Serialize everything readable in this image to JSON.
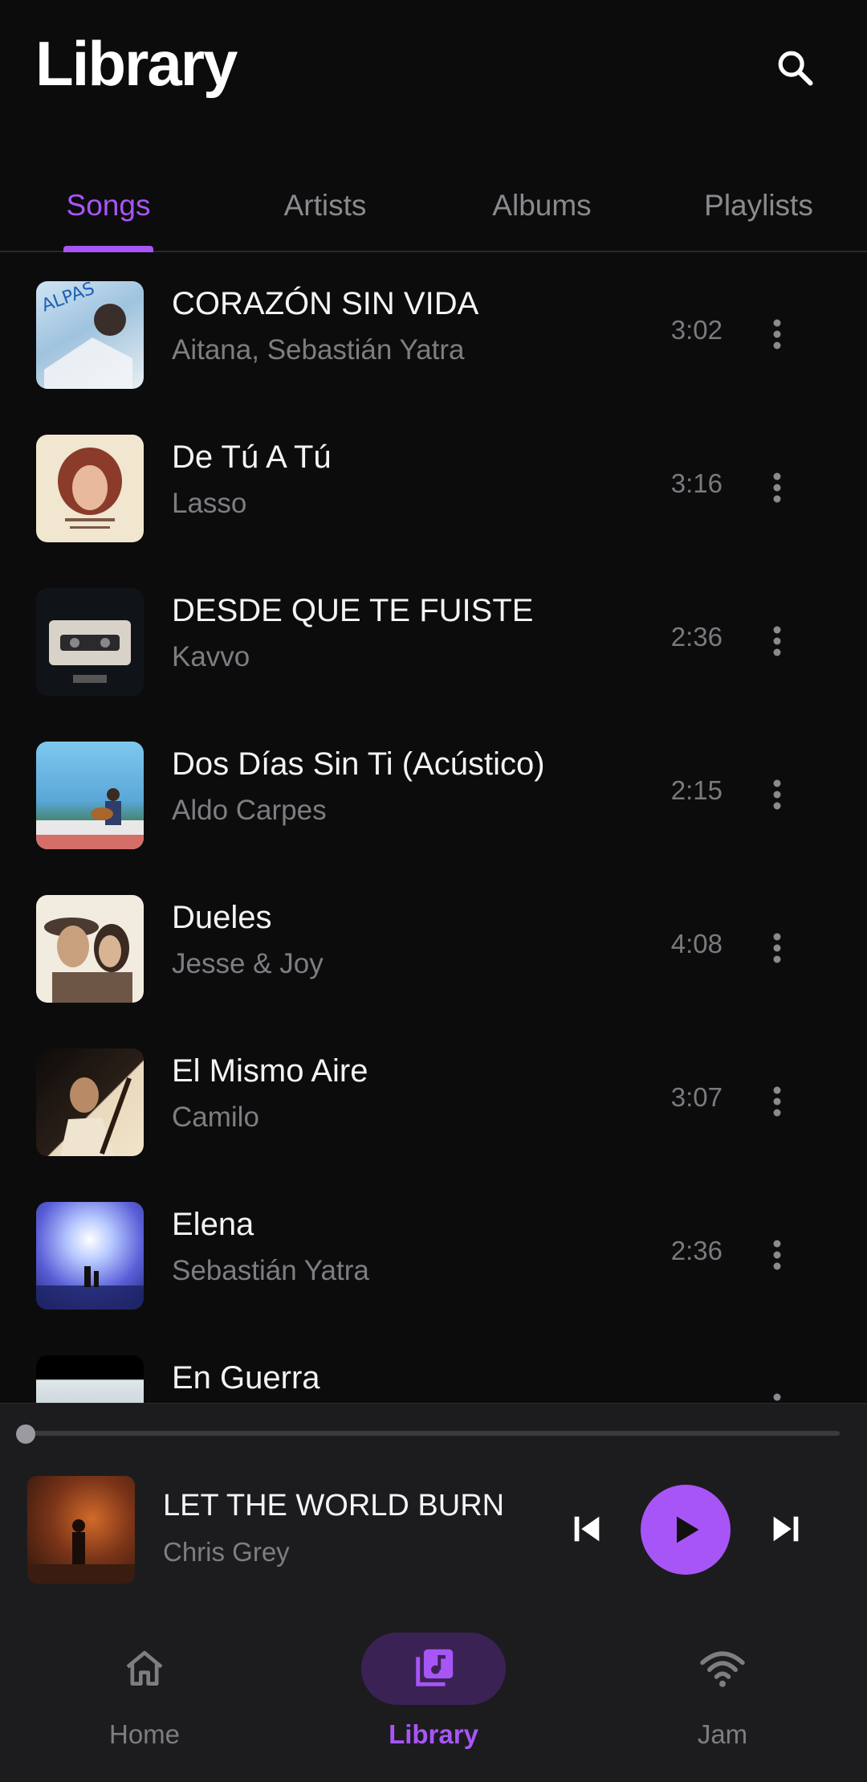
{
  "header": {
    "title": "Library",
    "search_icon": "search-icon"
  },
  "tabs": [
    {
      "label": "Songs",
      "active": true
    },
    {
      "label": "Artists",
      "active": false
    },
    {
      "label": "Albums",
      "active": false
    },
    {
      "label": "Playlists",
      "active": false
    }
  ],
  "songs": [
    {
      "title": "CORAZÓN SIN VIDA",
      "artist": "Aitana, Sebastián Yatra",
      "duration": "3:02"
    },
    {
      "title": "De Tú A Tú",
      "artist": "Lasso",
      "duration": "3:16"
    },
    {
      "title": "DESDE QUE TE FUISTE",
      "artist": "Kavvo",
      "duration": "2:36"
    },
    {
      "title": "Dos Días Sin Ti (Acústico)",
      "artist": "Aldo Carpes",
      "duration": "2:15"
    },
    {
      "title": "Dueles",
      "artist": "Jesse & Joy",
      "duration": "4:08"
    },
    {
      "title": "El Mismo Aire",
      "artist": "Camilo",
      "duration": "3:07"
    },
    {
      "title": "Elena",
      "artist": "Sebastián Yatra",
      "duration": "2:36"
    },
    {
      "title": "En Guerra",
      "artist": "",
      "duration": ""
    }
  ],
  "now_playing": {
    "title": "LET THE WORLD BURN",
    "artist": "Chris Grey",
    "progress": 0.0,
    "controls": {
      "prev_icon": "skip-previous-icon",
      "play_icon": "play-icon",
      "next_icon": "skip-next-icon"
    }
  },
  "bottom_nav": [
    {
      "label": "Home",
      "icon": "home-icon",
      "active": false
    },
    {
      "label": "Library",
      "icon": "library-music-icon",
      "active": true
    },
    {
      "label": "Jam",
      "icon": "wifi-icon",
      "active": false
    }
  ],
  "colors": {
    "accent": "#a855f7",
    "background": "#0c0c0d",
    "surface": "#1c1c1f",
    "text_primary": "#f4f4f6",
    "text_secondary": "#7d7d82"
  }
}
